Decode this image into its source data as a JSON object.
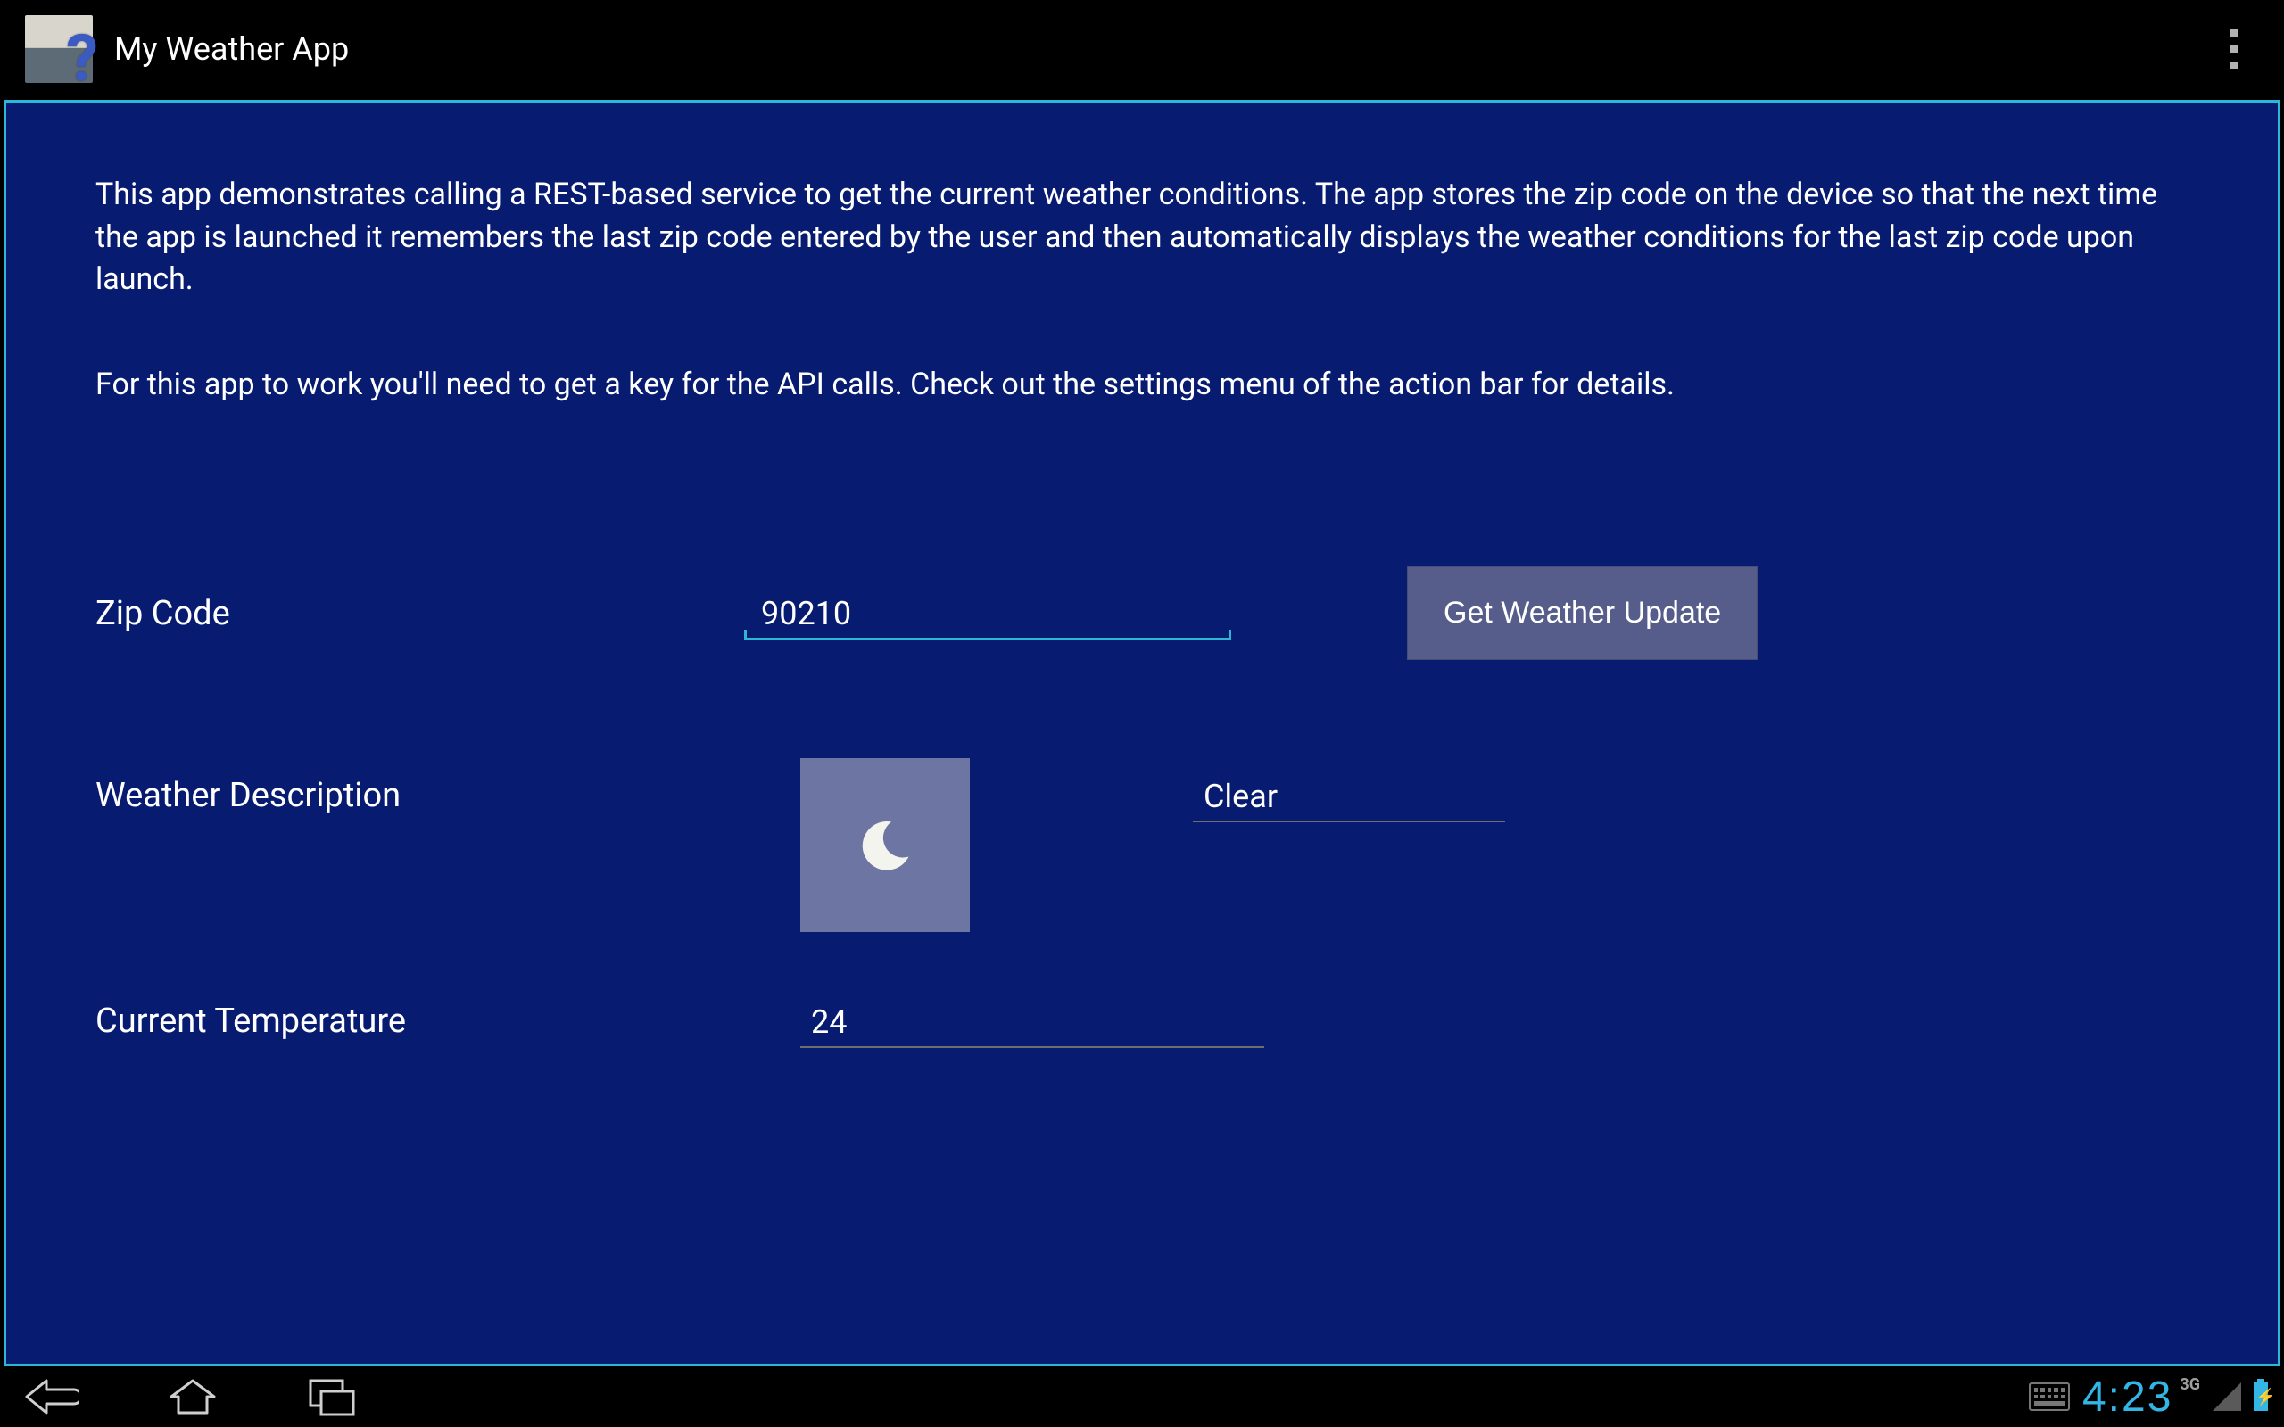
{
  "app": {
    "title": "My Weather App"
  },
  "content": {
    "intro1": "This app demonstrates calling a REST-based service to get the current weather conditions. The app stores the zip code on the device so that the next time the app is launched it remembers the last zip code entered by the user and then automatically displays the weather conditions for the last zip code upon launch.",
    "intro2": "For this app to work you'll need to get a key for the API calls. Check out the settings menu of the action bar for details.",
    "zip_label": "Zip Code",
    "zip_value": "90210",
    "button_label": "Get Weather Update",
    "weather_label": "Weather Description",
    "weather_value": "Clear",
    "weather_icon": "moon",
    "temp_label": "Current Temperature",
    "temp_value": "24"
  },
  "status": {
    "time": "4:23",
    "network": "3G"
  }
}
